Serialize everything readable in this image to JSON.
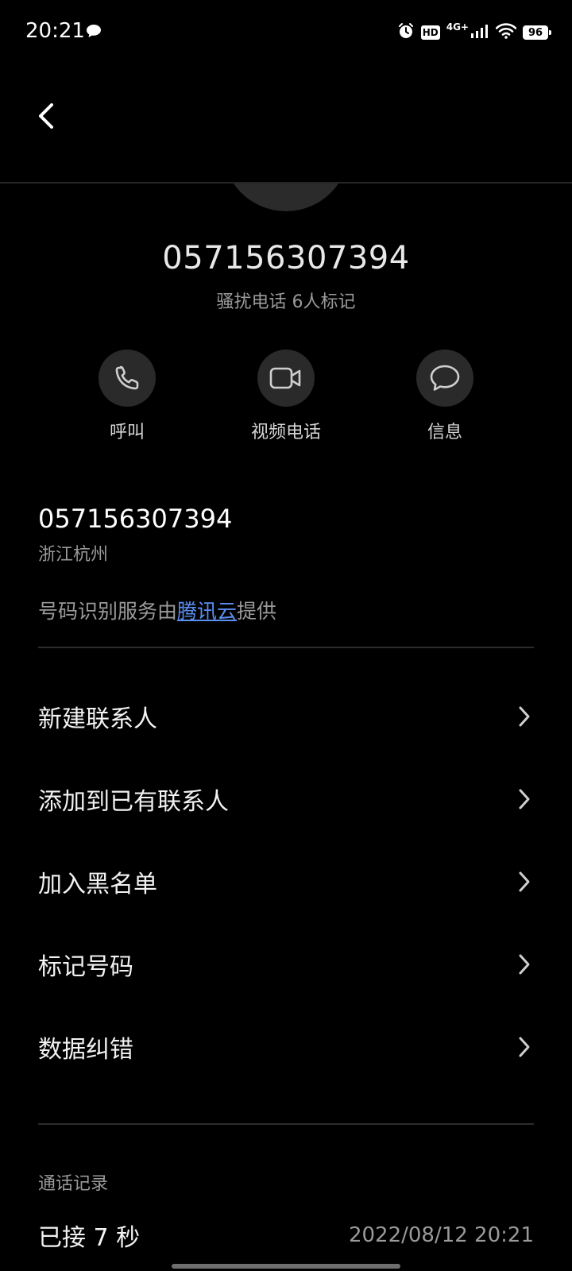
{
  "status_bar": {
    "time": "20:21",
    "hd": "HD",
    "network": "4G+",
    "battery": "96",
    "icons": [
      "message-bubble-icon",
      "alarm-icon",
      "hd-icon",
      "signal-icon",
      "wifi-icon",
      "battery-icon"
    ]
  },
  "header": {
    "number": "057156307394",
    "tag": "骚扰电话 6人标记"
  },
  "actions": [
    {
      "label": "呼叫",
      "icon": "phone-icon"
    },
    {
      "label": "视频电话",
      "icon": "video-camera-icon"
    },
    {
      "label": "信息",
      "icon": "message-icon"
    }
  ],
  "info": {
    "number": "057156307394",
    "location": "浙江杭州",
    "provider_prefix": "号码识别服务由",
    "provider_link": "腾讯云",
    "provider_suffix": "提供"
  },
  "menu": [
    {
      "label": "新建联系人"
    },
    {
      "label": "添加到已有联系人"
    },
    {
      "label": "加入黑名单"
    },
    {
      "label": "标记号码"
    },
    {
      "label": "数据纠错"
    }
  ],
  "call_log": {
    "title": "通话记录",
    "entries": [
      {
        "status": "已接 7 秒",
        "time": "2022/08/12 20:21"
      }
    ]
  },
  "colors": {
    "background": "#000000",
    "link": "#5b8ff2",
    "secondary_text": "#9a9a9a"
  }
}
